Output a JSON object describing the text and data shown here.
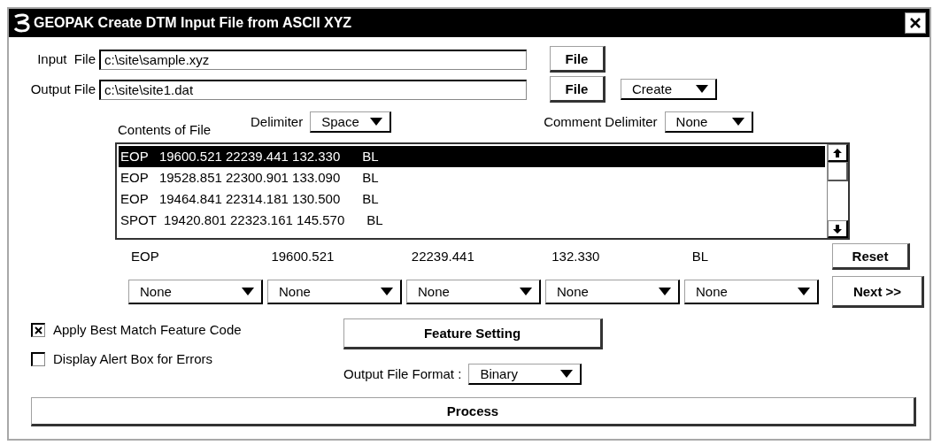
{
  "window": {
    "title": "GEOPAK Create DTM Input File from ASCII XYZ"
  },
  "input_file": {
    "label": "Input  File",
    "value": "c:\\site\\sample.xyz",
    "button": "File"
  },
  "output_file": {
    "label": "Output File",
    "value": "c:\\site\\site1.dat",
    "button": "File",
    "mode": "Create"
  },
  "contents_label": "Contents of File",
  "delimiter": {
    "label": "Delimiter",
    "value": "Space"
  },
  "comment_delimiter": {
    "label": "Comment Delimiter",
    "value": "None"
  },
  "file_lines": [
    {
      "text": "EOP   19600.521 22239.441 132.330      BL",
      "selected": true
    },
    {
      "text": "EOP   19528.851 22300.901 133.090      BL",
      "selected": false
    },
    {
      "text": "EOP   19464.841 22314.181 130.500      BL",
      "selected": false
    },
    {
      "text": "SPOT  19420.801 22323.161 145.570      BL",
      "selected": false
    }
  ],
  "parsed_fields": [
    "EOP",
    "19600.521",
    "22239.441",
    "132.330",
    "BL"
  ],
  "field_types": [
    "None",
    "None",
    "None",
    "None",
    "None"
  ],
  "reset_button": "Reset",
  "next_button": "Next >>",
  "checkboxes": [
    {
      "label": "Apply Best Match Feature Code",
      "checked": true
    },
    {
      "label": "Display Alert Box for Errors",
      "checked": false
    }
  ],
  "feature_setting_button": "Feature Setting",
  "output_format": {
    "label": "Output File Format :",
    "value": "Binary"
  },
  "process_button": "Process"
}
